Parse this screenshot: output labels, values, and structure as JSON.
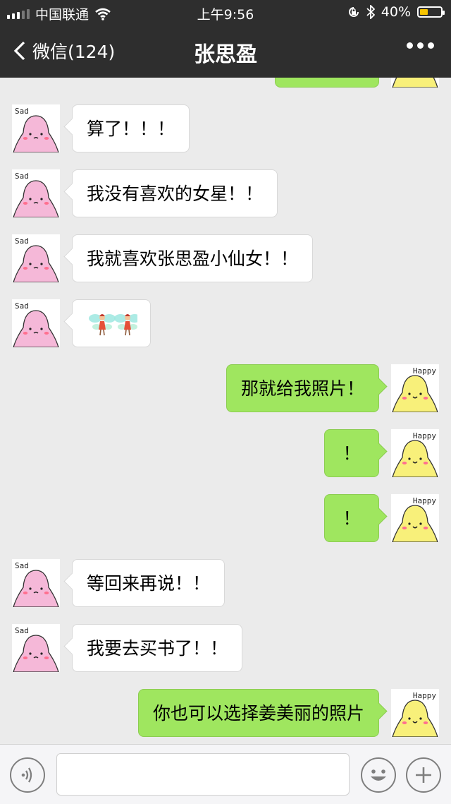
{
  "status_bar": {
    "carrier": "中国联通",
    "time": "上午9:56",
    "battery_text": "40%",
    "battery_level": 0.4,
    "battery_color": "#f7c400",
    "icons": [
      "signal-icon",
      "wifi-icon",
      "orientation-lock-icon",
      "bluetooth-icon",
      "battery-icon"
    ]
  },
  "nav": {
    "back_label": "微信(124)",
    "title": "张思盈",
    "more_icon": "more-icon"
  },
  "avatars": {
    "contact_tag": "Sad",
    "contact_color": "#f5b8d8",
    "self_tag": "Happy",
    "self_color": "#f8f07a"
  },
  "messages": [
    {
      "side": "in",
      "text": "算了！！！"
    },
    {
      "side": "in",
      "text": "我没有喜欢的女星！！"
    },
    {
      "side": "in",
      "text": "我就喜欢张思盈小仙女！！"
    },
    {
      "side": "in",
      "emoji": "fairy-emoji"
    },
    {
      "side": "out",
      "text": "那就给我照片！"
    },
    {
      "side": "out",
      "text": "！"
    },
    {
      "side": "out",
      "text": "！"
    },
    {
      "side": "in",
      "text": "等回来再说！！"
    },
    {
      "side": "in",
      "text": "我要去买书了！！"
    },
    {
      "side": "out",
      "text": "你也可以选择姜美丽的照片"
    }
  ],
  "input_bar": {
    "voice_icon": "voice-icon",
    "emoji_icon": "emoji-icon",
    "plus_icon": "plus-icon",
    "placeholder": ""
  },
  "colors": {
    "outgoing_bubble": "#9fe65f",
    "incoming_bubble": "#ffffff",
    "chat_background": "#ebebeb",
    "nav_background": "#2e2e2e"
  }
}
